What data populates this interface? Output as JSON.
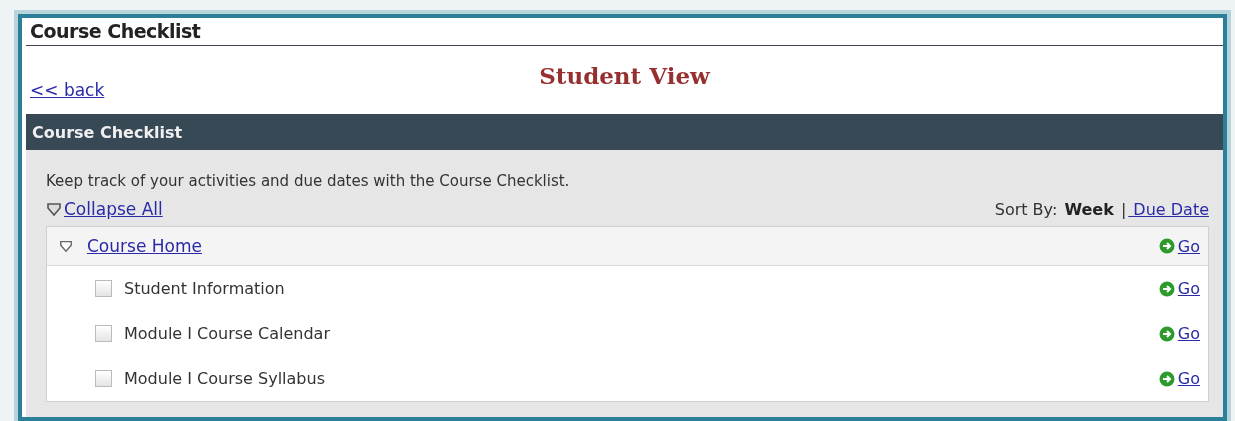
{
  "page_title": "Course Checklist",
  "back_link": "<< back",
  "banner": "Student View",
  "panel": {
    "title": "Course Checklist",
    "description": "Keep track of your activities and due dates with the Course Checklist.",
    "collapse_all": "Collapse All",
    "sort": {
      "label": "Sort By:",
      "separator": "|",
      "options": [
        {
          "label": "Week",
          "selected": true
        },
        {
          "label": " Due Date",
          "selected": false
        }
      ]
    },
    "groups": [
      {
        "title": "Course Home",
        "expanded": true,
        "go": "Go",
        "items": [
          {
            "label": "Student Information",
            "checked": false,
            "go": "Go"
          },
          {
            "label": "Module I Course Calendar",
            "checked": false,
            "go": "Go"
          },
          {
            "label": "Module I Course Syllabus",
            "checked": false,
            "go": "Go"
          }
        ]
      }
    ]
  }
}
